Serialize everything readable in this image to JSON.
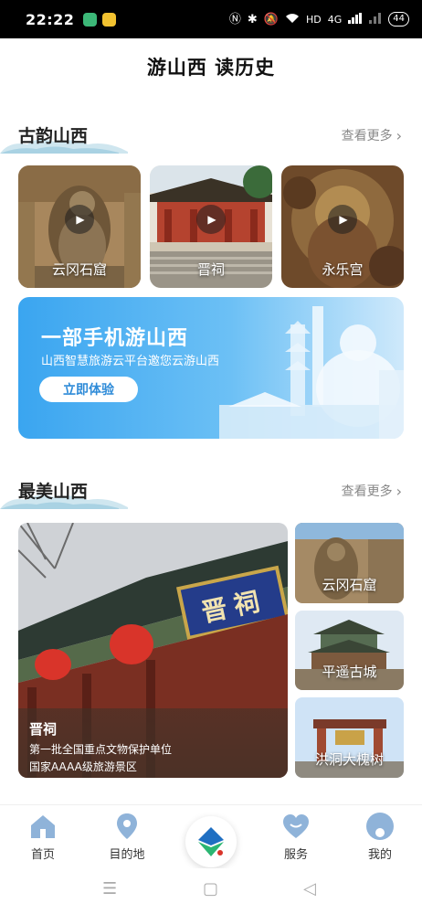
{
  "status_bar": {
    "time": "22:22",
    "hd_label": "HD",
    "network_label": "4G",
    "battery": "44"
  },
  "header": {
    "title": "游山西 读历史"
  },
  "section1": {
    "title": "古韵山西",
    "see_more": "查看更多"
  },
  "video_cards": [
    {
      "label": "云冈石窟",
      "icon": "play-icon"
    },
    {
      "label": "晋祠",
      "icon": "play-icon"
    },
    {
      "label": "永乐宫",
      "icon": "play-icon"
    }
  ],
  "banner": {
    "title": "一部手机游山西",
    "subtitle": "山西智慧旅游云平台邀您云游山西",
    "button": "立即体验"
  },
  "section2": {
    "title": "最美山西",
    "see_more": "查看更多"
  },
  "feature": {
    "name": "晋祠",
    "line1": "第一批全国重点文物保护单位",
    "line2": "国家AAAA级旅游景区",
    "plaque_text": "晋祠"
  },
  "small_cards": [
    {
      "label": "云冈石窟"
    },
    {
      "label": "平遥古城"
    },
    {
      "label": "洪洞大槐树"
    }
  ],
  "bottom_nav": [
    {
      "label": "首页",
      "icon": "home-icon"
    },
    {
      "label": "目的地",
      "icon": "location-pin-icon"
    },
    {
      "label": "服务",
      "icon": "heart-icon"
    },
    {
      "label": "我的",
      "icon": "profile-icon"
    }
  ],
  "colors": {
    "banner_blue": "#3aa5f0",
    "nav_icon_blue": "#8fb3d9",
    "logo_green": "#2bb673",
    "logo_blue": "#1f6fc2"
  }
}
